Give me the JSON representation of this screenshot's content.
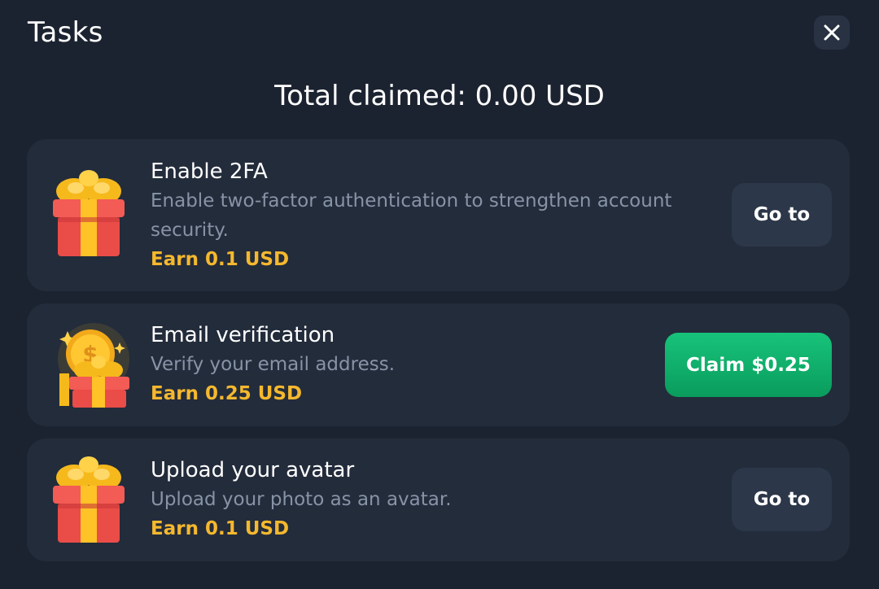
{
  "header": {
    "title": "Tasks",
    "close_icon": "close-icon"
  },
  "summary": {
    "total_claimed": "Total claimed: 0.00 USD"
  },
  "tasks": [
    {
      "icon": "gift-icon",
      "title": "Enable 2FA",
      "description": "Enable two-factor authentication to strengthen account security.",
      "reward": "Earn 0.1 USD",
      "action_label": "Go to"
    },
    {
      "icon": "coin-gift-icon",
      "title": "Email verification",
      "description": "Verify your email address.",
      "reward": "Earn 0.25 USD",
      "action_label": "Claim $0.25"
    },
    {
      "icon": "gift-icon",
      "title": "Upload your avatar",
      "description": "Upload your photo as an avatar.",
      "reward": "Earn 0.1 USD",
      "action_label": "Go to"
    }
  ],
  "colors": {
    "background": "#1c2330",
    "card": "#232c3b",
    "reward": "#f5b82e",
    "claim_button": "#0fb06c",
    "goto_button": "#2c3749"
  }
}
